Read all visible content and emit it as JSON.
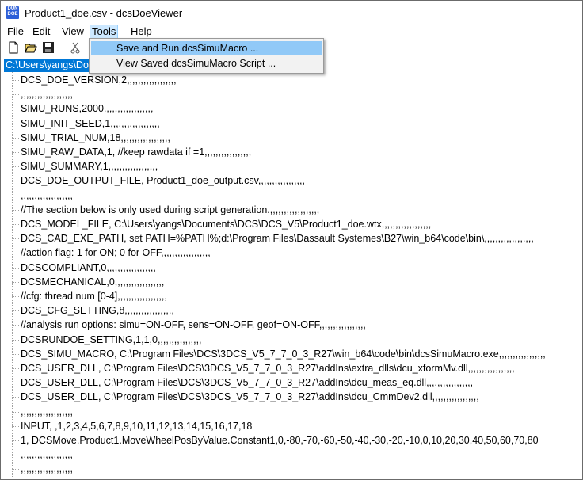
{
  "window": {
    "title": "Product1_doe.csv - dcsDoeViewer",
    "icon_text": [
      "DUN",
      "DOE"
    ]
  },
  "menubar": {
    "items": [
      {
        "label": "File",
        "name": "menu-file"
      },
      {
        "label": "Edit",
        "name": "menu-edit"
      },
      {
        "label": "View",
        "name": "menu-view"
      },
      {
        "label": "Tools",
        "name": "menu-tools"
      },
      {
        "label": "Help",
        "name": "menu-help"
      }
    ]
  },
  "toolbar": {
    "buttons": [
      "new-file-icon",
      "open-folder-icon",
      "save-icon",
      "cut-icon"
    ]
  },
  "tools_menu": {
    "items": [
      {
        "label": "Save and Run dcsSimuMacro ...",
        "name": "menu-save-and-run-macro"
      },
      {
        "label": "View Saved dcsSimuMacro Script ...",
        "name": "menu-view-saved-macro"
      }
    ]
  },
  "tree": {
    "root": "C:\\Users\\yangs\\Do",
    "lines": [
      "DCS_DOE_VERSION,2,,,,,,,,,,,,,,,,,,",
      ",,,,,,,,,,,,,,,,,,,",
      "SIMU_RUNS,2000,,,,,,,,,,,,,,,,,,",
      "SIMU_INIT_SEED,1,,,,,,,,,,,,,,,,,,",
      "SIMU_TRIAL_NUM,18,,,,,,,,,,,,,,,,,,",
      "SIMU_RAW_DATA,1,  //keep rawdata if =1,,,,,,,,,,,,,,,,,",
      "SIMU_SUMMARY,1,,,,,,,,,,,,,,,,,,",
      "DCS_DOE_OUTPUT_FILE, Product1_doe_output.csv,,,,,,,,,,,,,,,,,",
      ",,,,,,,,,,,,,,,,,,,",
      "//The section below is only used during script generation.,,,,,,,,,,,,,,,,,,",
      "DCS_MODEL_FILE, C:\\Users\\yangs\\Documents\\DCS\\DCS_V5\\Product1_doe.wtx,,,,,,,,,,,,,,,,,,",
      "DCS_CAD_EXE_PATH, set PATH=%PATH%;d:\\Program Files\\Dassault Systemes\\B27\\win_b64\\code\\bin\\,,,,,,,,,,,,,,,,,,",
      "//action flag: 1 for ON; 0 for OFF,,,,,,,,,,,,,,,,,,",
      "DCSCOMPLIANT,0,,,,,,,,,,,,,,,,,,",
      "DCSMECHANICAL,0,,,,,,,,,,,,,,,,,,",
      "//cfg: thread num [0-4],,,,,,,,,,,,,,,,,,",
      "DCS_CFG_SETTING,8,,,,,,,,,,,,,,,,,,",
      "//analysis run options: simu=ON-OFF, sens=ON-OFF, geof=ON-OFF,,,,,,,,,,,,,,,,,",
      "DCSRUNDOE_SETTING,1,1,0,,,,,,,,,,,,,,,,",
      "DCS_SIMU_MACRO, C:\\Program Files\\DCS\\3DCS_V5_7_7_0_3_R27\\win_b64\\code\\bin\\dcsSimuMacro.exe,,,,,,,,,,,,,,,,,",
      "DCS_USER_DLL, C:\\Program Files\\DCS\\3DCS_V5_7_7_0_3_R27\\addIns\\extra_dlls\\dcu_xformMv.dll,,,,,,,,,,,,,,,,,",
      "DCS_USER_DLL, C:\\Program Files\\DCS\\3DCS_V5_7_7_0_3_R27\\addIns\\dcu_meas_eq.dll,,,,,,,,,,,,,,,,,",
      "DCS_USER_DLL, C:\\Program Files\\DCS\\3DCS_V5_7_7_0_3_R27\\addIns\\dcu_CmmDev2.dll,,,,,,,,,,,,,,,,,",
      ",,,,,,,,,,,,,,,,,,,",
      "INPUT, ,1,2,3,4,5,6,7,8,9,10,11,12,13,14,15,16,17,18",
      "1, DCSMove.Product1.MoveWheelPosByValue.Constant1,0,-80,-70,-60,-50,-40,-30,-20,-10,0,10,20,30,40,50,60,70,80",
      ",,,,,,,,,,,,,,,,,,,",
      ",,,,,,,,,,,,,,,,,,,"
    ]
  }
}
